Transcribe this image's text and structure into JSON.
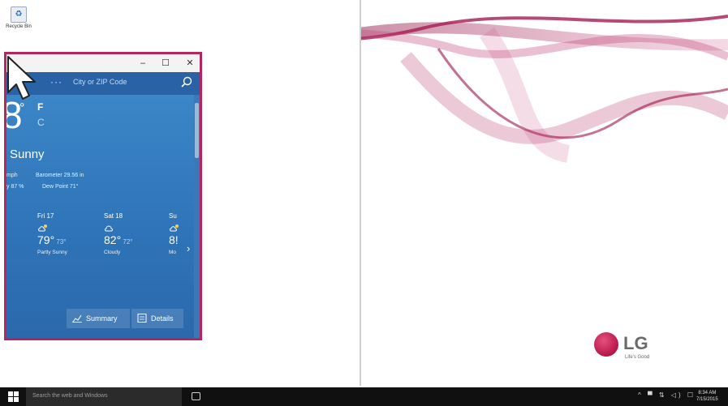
{
  "desktop": {
    "recycle_bin_label": "Recycle Bin",
    "accent_color": "#b5265e"
  },
  "weather_app": {
    "search_placeholder": "City or ZIP Code",
    "menu_dots": "···",
    "temperature": "8",
    "degree_symbol": "°",
    "unit_f": "F",
    "unit_c": "C",
    "condition": "Sunny",
    "wind": "mph",
    "barometer": "Barometer  29.56 in",
    "humidity": "y  87 %",
    "dew_point": "Dew Point  71°",
    "forecast": [
      {
        "day": "Fri 17",
        "icon": "partly-sunny-icon",
        "high": "79°",
        "low": "73°",
        "desc": "Partly Sunny"
      },
      {
        "day": "Sat 18",
        "icon": "cloudy-icon",
        "high": "82°",
        "low": "72°",
        "desc": "Cloudy"
      },
      {
        "day": "Su",
        "icon": "partly-sunny-icon",
        "high": "8!",
        "low": "",
        "desc": "Mo"
      }
    ],
    "summary_label": "Summary",
    "details_label": "Details",
    "title_buttons": {
      "minimize": "–",
      "maximize": "☐",
      "close": "✕"
    }
  },
  "brand": {
    "logo_text": "LG",
    "tagline": "Life's Good"
  },
  "taskbar": {
    "search_placeholder": "Search the web and Windows",
    "tray_icons": "^ ▀ ⇅ ◁) ☐",
    "time": "8:34 AM",
    "date": "7/15/2015"
  }
}
